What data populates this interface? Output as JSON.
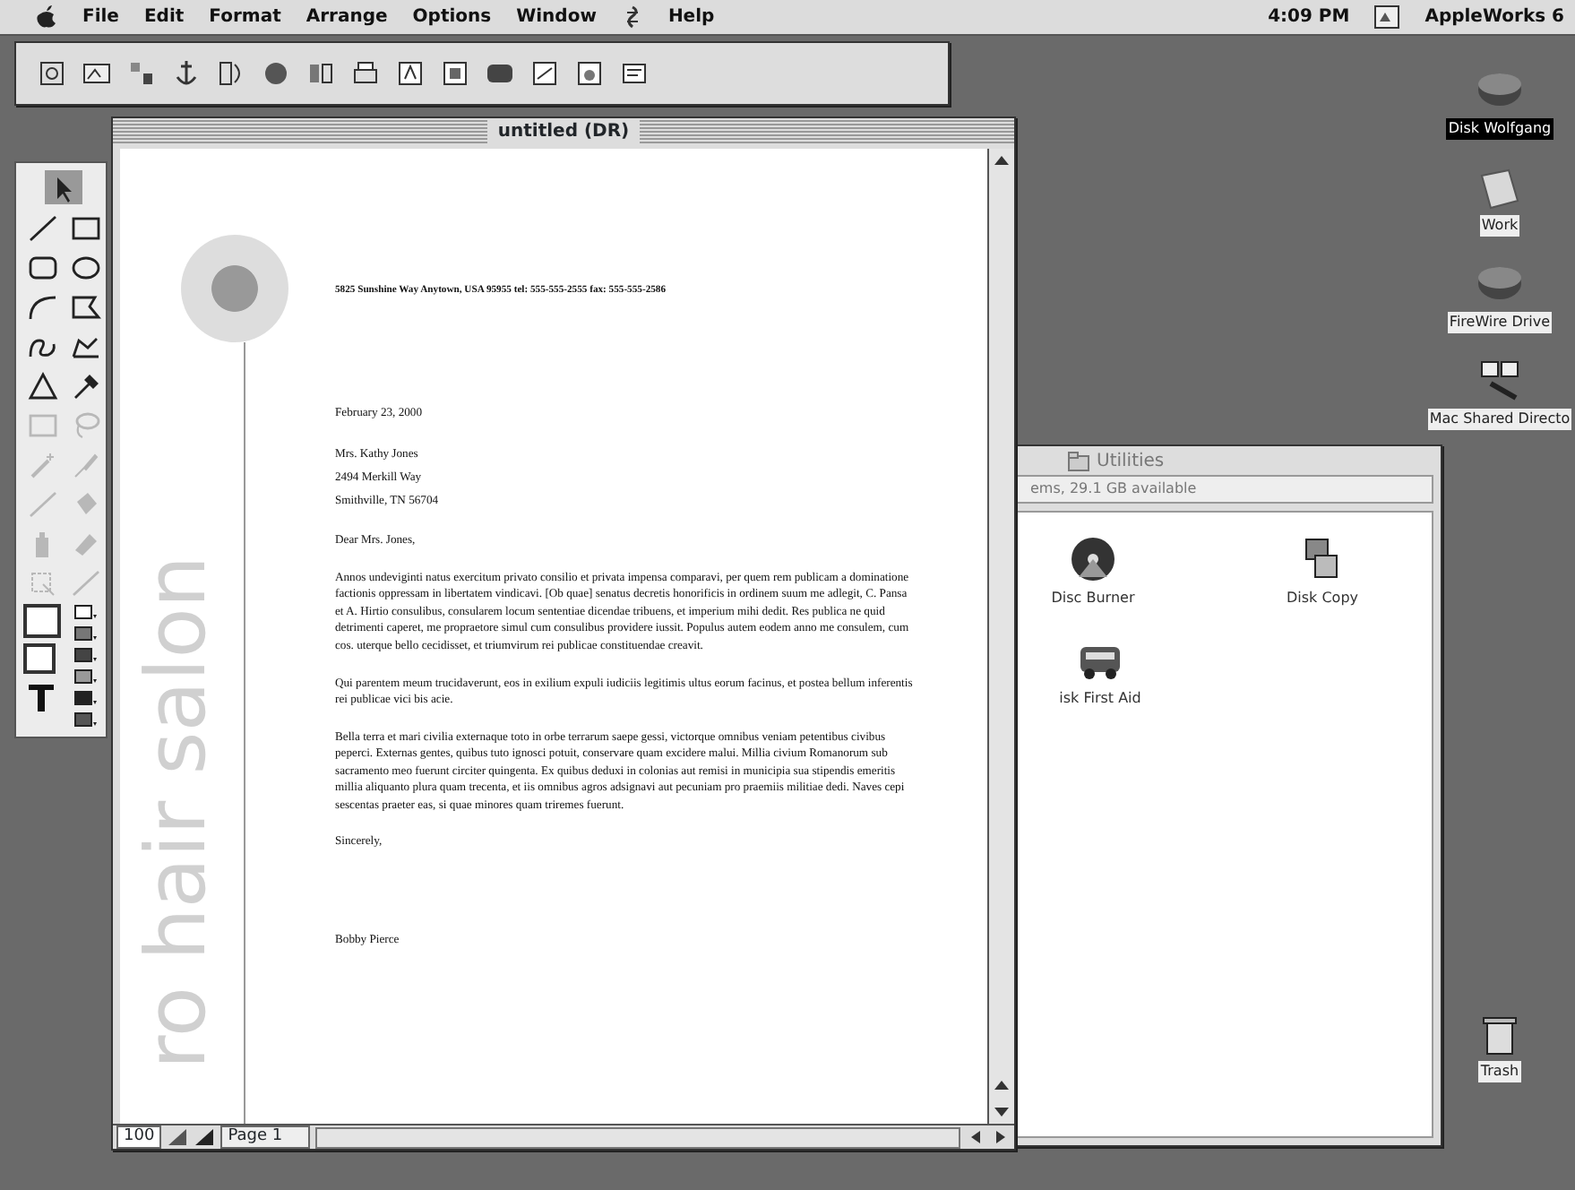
{
  "menu_bar": {
    "menus": [
      "File",
      "Edit",
      "Format",
      "Arrange",
      "Options",
      "Window",
      "Help"
    ],
    "clock": "4:09 PM",
    "application": "AppleWorks 6"
  },
  "document_window": {
    "title": "untitled (DR)",
    "zoom": "100",
    "page": "Page 1",
    "letter": {
      "side_text": "ro hair salon",
      "address_line": "5825 Sunshine Way  Anytown, USA 95955   tel: 555-555-2555   fax: 555-555-2586",
      "date": "February 23, 2000",
      "recipient": [
        "Mrs. Kathy Jones",
        "2494 Merkill Way",
        "Smithville, TN 56704"
      ],
      "salutation": "Dear Mrs. Jones,",
      "paragraphs": [
        "Annos undeviginti natus exercitum privato consilio et privata impensa comparavi, per quem rem publicam a dominatione factionis oppressam in libertatem vindicavi. [Ob quae] senatus decretis honorificis in ordinem suum me adlegit, C. Pansa et A. Hirtio consulibus, consularem locum sententiae dicendae tribuens, et imperium mihi dedit. Res publica ne quid detrimenti caperet, me propraetore simul cum consulibus providere iussit. Populus autem eodem anno me consulem, cum cos. uterque bello cecidisset, et triumvirum rei publicae constituendae creavit.",
        "Qui parentem meum trucidaverunt, eos in exilium expuli iudiciis legitimis ultus eorum facinus, et postea bellum inferentis rei publicae vici bis acie.",
        "Bella terra et mari civilia externaque toto in orbe terrarum saepe gessi, victorque omnibus veniam petentibus civibus peperci. Externas gentes, quibus tuto ignosci potuit, conservare quam excidere malui. Millia civium Romanorum sub sacramento meo fuerunt circiter quingenta. Ex quibus deduxi in colonias aut remisi in municipia sua stipendis emeritis millia aliquanto plura quam trecenta, et iis omnibus agros adsignavi aut pecuniam pro praemiis militiae dedi. Naves cepi sescentas praeter eas, si quae minores quam triremes fuerunt."
      ],
      "closing": "Sincerely,",
      "signature": "Bobby Pierce"
    }
  },
  "tools": [
    {
      "kind": "pointer",
      "selected": true,
      "disabled": false
    },
    {
      "kind": "line",
      "selected": false,
      "disabled": false
    },
    {
      "kind": "rect",
      "selected": false,
      "disabled": false
    },
    {
      "kind": "round-rect",
      "selected": false,
      "disabled": false
    },
    {
      "kind": "oval",
      "selected": false,
      "disabled": false
    },
    {
      "kind": "arc",
      "selected": false,
      "disabled": false
    },
    {
      "kind": "polygon",
      "selected": false,
      "disabled": false
    },
    {
      "kind": "freehand",
      "selected": false,
      "disabled": false
    },
    {
      "kind": "reshape",
      "selected": false,
      "disabled": false
    },
    {
      "kind": "triangle",
      "selected": false,
      "disabled": false
    },
    {
      "kind": "eyedropper",
      "selected": false,
      "disabled": false
    },
    {
      "kind": "rect",
      "selected": false,
      "disabled": true
    },
    {
      "kind": "lasso",
      "selected": false,
      "disabled": true
    },
    {
      "kind": "wand",
      "selected": false,
      "disabled": true
    },
    {
      "kind": "brush",
      "selected": false,
      "disabled": true
    },
    {
      "kind": "line",
      "selected": false,
      "disabled": true
    },
    {
      "kind": "bucket",
      "selected": false,
      "disabled": true
    },
    {
      "kind": "spray",
      "selected": false,
      "disabled": true
    },
    {
      "kind": "eraser",
      "selected": false,
      "disabled": true
    },
    {
      "kind": "transform",
      "selected": false,
      "disabled": true
    },
    {
      "kind": "line",
      "selected": false,
      "disabled": true
    }
  ],
  "utilities_window": {
    "title": "Utilities",
    "info": "ems, 29.1 GB available",
    "items": [
      {
        "kind": "disc",
        "label": "Disc Burner"
      },
      {
        "kind": "copy",
        "label": "Disk Copy"
      },
      {
        "kind": "aid",
        "label": "isk First Aid"
      }
    ]
  },
  "desktop_icons": [
    {
      "kind": "disk",
      "label": "Disk Wolfgang",
      "selected": true
    },
    {
      "kind": "folder",
      "label": "Work",
      "selected": false
    },
    {
      "kind": "disk",
      "label": "FireWire Drive",
      "selected": false
    },
    {
      "kind": "share",
      "label": "Mac Shared Directo",
      "selected": false
    },
    {
      "kind": "trash",
      "label": "Trash",
      "selected": false
    }
  ]
}
